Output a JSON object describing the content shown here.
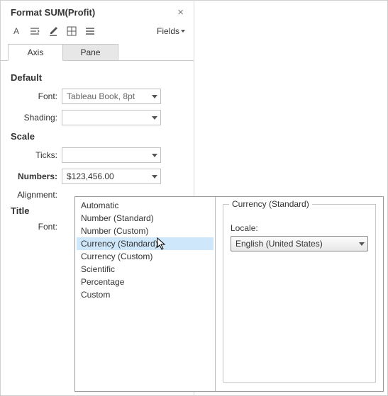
{
  "header": {
    "title": "Format SUM(Profit)"
  },
  "toolbar": {
    "fields_label": "Fields"
  },
  "tabs": {
    "axis": "Axis",
    "pane": "Pane",
    "active": "axis"
  },
  "sections": {
    "default": {
      "heading": "Default",
      "font_label": "Font:",
      "font_value": "Tableau Book, 8pt",
      "shading_label": "Shading:",
      "shading_value": ""
    },
    "scale": {
      "heading": "Scale",
      "ticks_label": "Ticks:",
      "ticks_value": "",
      "numbers_label": "Numbers:",
      "numbers_value": "$123,456.00",
      "alignment_label": "Alignment:"
    },
    "title": {
      "heading": "Title",
      "font_label": "Font:"
    }
  },
  "number_format_popup": {
    "options": [
      "Automatic",
      "Number (Standard)",
      "Number (Custom)",
      "Currency (Standard)",
      "Currency (Custom)",
      "Scientific",
      "Percentage",
      "Custom"
    ],
    "selected_index": 3,
    "detail_legend": "Currency (Standard)",
    "locale_label": "Locale:",
    "locale_value": "English (United States)"
  },
  "chart_data": null
}
